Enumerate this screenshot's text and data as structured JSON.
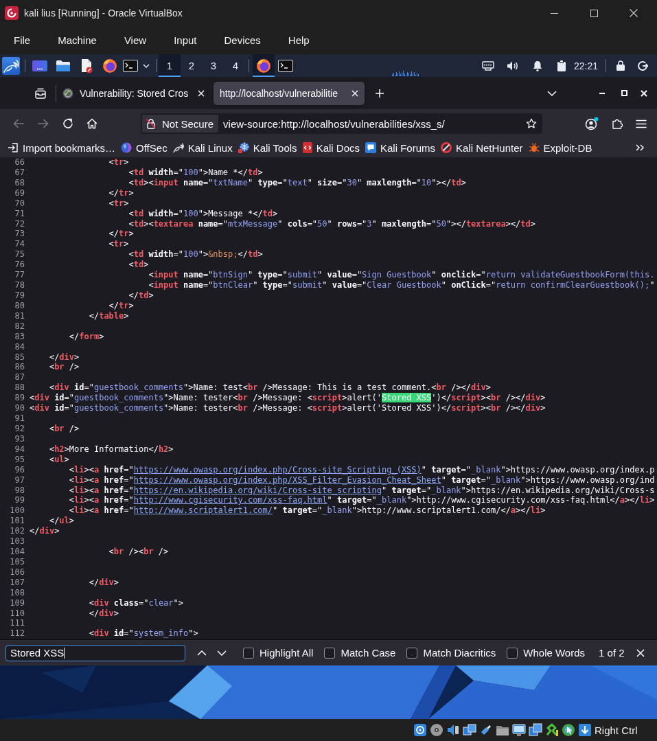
{
  "window": {
    "title": "kali lius [Running] - Oracle VirtualBox"
  },
  "menu_bar": [
    "File",
    "Machine",
    "View",
    "Input",
    "Devices",
    "Help"
  ],
  "panel": {
    "workspaces": [
      {
        "label": "1",
        "selected": true
      },
      {
        "label": "2",
        "selected": false
      },
      {
        "label": "3",
        "selected": false
      },
      {
        "label": "4",
        "selected": false
      }
    ],
    "tasks": [
      {
        "kind": "browser",
        "selected": true
      },
      {
        "kind": "terminal",
        "selected": false
      }
    ],
    "clock": "22:21"
  },
  "browser": {
    "tabs": [
      {
        "title": "Vulnerability: Stored Cros",
        "favicon": true,
        "selected": false
      },
      {
        "title": "http://localhost/vulnerabilitie",
        "favicon": false,
        "selected": true
      }
    ],
    "nav_buttons": [
      {
        "kind": "back",
        "disabled": true
      },
      {
        "kind": "forward",
        "disabled": true
      },
      {
        "kind": "reload",
        "disabled": false
      },
      {
        "kind": "home",
        "disabled": false
      }
    ],
    "security_label": "Not Secure",
    "url": "view-source:http://localhost/vulnerabilities/xss_s/",
    "bookmarks": [
      {
        "kind": "import",
        "label": "Import bookmarks…"
      },
      {
        "kind": "orb",
        "label": "OffSec"
      },
      {
        "kind": "dragon",
        "label": "Kali Linux"
      },
      {
        "kind": "globe",
        "label": "Kali Tools"
      },
      {
        "kind": "document",
        "label": "Kali Docs"
      },
      {
        "kind": "chat",
        "label": "Kali Forums"
      },
      {
        "kind": "ring",
        "label": "Kali NetHunter"
      },
      {
        "kind": "bug",
        "label": "Exploit-DB"
      }
    ]
  },
  "source": {
    "lines": [
      {
        "number": "66",
        "segments": [
          {
            "kind": "plain",
            "text": "                <"
          },
          {
            "kind": "tag",
            "text": "tr"
          },
          {
            "kind": "plain",
            "text": ">"
          }
        ]
      },
      {
        "number": "67",
        "segments": [
          {
            "kind": "plain",
            "text": "                    <"
          },
          {
            "kind": "tag",
            "text": "td"
          },
          {
            "kind": "attr",
            "text": " width"
          },
          {
            "kind": "plain",
            "text": "=\""
          },
          {
            "kind": "value",
            "text": "100"
          },
          {
            "kind": "plain",
            "text": "\">Name *</"
          },
          {
            "kind": "tag",
            "text": "td"
          },
          {
            "kind": "plain",
            "text": ">"
          }
        ]
      },
      {
        "number": "68",
        "segments": [
          {
            "kind": "plain",
            "text": "                    <"
          },
          {
            "kind": "tag",
            "text": "td"
          },
          {
            "kind": "plain",
            "text": "><"
          },
          {
            "kind": "tag",
            "text": "input"
          },
          {
            "kind": "attr",
            "text": " name"
          },
          {
            "kind": "plain",
            "text": "=\""
          },
          {
            "kind": "value",
            "text": "txtName"
          },
          {
            "kind": "plain",
            "text": "\" "
          },
          {
            "kind": "attr",
            "text": "type"
          },
          {
            "kind": "plain",
            "text": "=\""
          },
          {
            "kind": "value",
            "text": "text"
          },
          {
            "kind": "plain",
            "text": "\" "
          },
          {
            "kind": "attr",
            "text": "size"
          },
          {
            "kind": "plain",
            "text": "=\""
          },
          {
            "kind": "value",
            "text": "30"
          },
          {
            "kind": "plain",
            "text": "\" "
          },
          {
            "kind": "attr",
            "text": "maxlength"
          },
          {
            "kind": "plain",
            "text": "=\""
          },
          {
            "kind": "value",
            "text": "10"
          },
          {
            "kind": "plain",
            "text": "\"></"
          },
          {
            "kind": "tag",
            "text": "td"
          },
          {
            "kind": "plain",
            "text": ">"
          }
        ]
      },
      {
        "number": "69",
        "segments": [
          {
            "kind": "plain",
            "text": "                </"
          },
          {
            "kind": "tag",
            "text": "tr"
          },
          {
            "kind": "plain",
            "text": ">"
          }
        ]
      },
      {
        "number": "70",
        "segments": [
          {
            "kind": "plain",
            "text": "                <"
          },
          {
            "kind": "tag",
            "text": "tr"
          },
          {
            "kind": "plain",
            "text": ">"
          }
        ]
      },
      {
        "number": "71",
        "segments": [
          {
            "kind": "plain",
            "text": "                    <"
          },
          {
            "kind": "tag",
            "text": "td"
          },
          {
            "kind": "attr",
            "text": " width"
          },
          {
            "kind": "plain",
            "text": "=\""
          },
          {
            "kind": "value",
            "text": "100"
          },
          {
            "kind": "plain",
            "text": "\">Message *</"
          },
          {
            "kind": "tag",
            "text": "td"
          },
          {
            "kind": "plain",
            "text": ">"
          }
        ]
      },
      {
        "number": "72",
        "segments": [
          {
            "kind": "plain",
            "text": "                    <"
          },
          {
            "kind": "tag",
            "text": "td"
          },
          {
            "kind": "plain",
            "text": "><"
          },
          {
            "kind": "tag",
            "text": "textarea"
          },
          {
            "kind": "attr",
            "text": " name"
          },
          {
            "kind": "plain",
            "text": "=\""
          },
          {
            "kind": "value",
            "text": "mtxMessage"
          },
          {
            "kind": "plain",
            "text": "\" "
          },
          {
            "kind": "attr",
            "text": "cols"
          },
          {
            "kind": "plain",
            "text": "=\""
          },
          {
            "kind": "value",
            "text": "50"
          },
          {
            "kind": "plain",
            "text": "\" "
          },
          {
            "kind": "attr",
            "text": "rows"
          },
          {
            "kind": "plain",
            "text": "=\""
          },
          {
            "kind": "value",
            "text": "3"
          },
          {
            "kind": "plain",
            "text": "\" "
          },
          {
            "kind": "attr",
            "text": "maxlength"
          },
          {
            "kind": "plain",
            "text": "=\""
          },
          {
            "kind": "value",
            "text": "50"
          },
          {
            "kind": "plain",
            "text": "\"></"
          },
          {
            "kind": "tag",
            "text": "textarea"
          },
          {
            "kind": "plain",
            "text": "></"
          },
          {
            "kind": "tag",
            "text": "td"
          },
          {
            "kind": "plain",
            "text": ">"
          }
        ]
      },
      {
        "number": "73",
        "segments": [
          {
            "kind": "plain",
            "text": "                </"
          },
          {
            "kind": "tag",
            "text": "tr"
          },
          {
            "kind": "plain",
            "text": ">"
          }
        ]
      },
      {
        "number": "74",
        "segments": [
          {
            "kind": "plain",
            "text": "                <"
          },
          {
            "kind": "tag",
            "text": "tr"
          },
          {
            "kind": "plain",
            "text": ">"
          }
        ]
      },
      {
        "number": "75",
        "segments": [
          {
            "kind": "plain",
            "text": "                    <"
          },
          {
            "kind": "tag",
            "text": "td"
          },
          {
            "kind": "attr",
            "text": " width"
          },
          {
            "kind": "plain",
            "text": "=\""
          },
          {
            "kind": "value",
            "text": "100"
          },
          {
            "kind": "plain",
            "text": "\">"
          },
          {
            "kind": "entity",
            "text": "&nbsp;"
          },
          {
            "kind": "plain",
            "text": "</"
          },
          {
            "kind": "tag",
            "text": "td"
          },
          {
            "kind": "plain",
            "text": ">"
          }
        ]
      },
      {
        "number": "76",
        "segments": [
          {
            "kind": "plain",
            "text": "                    <"
          },
          {
            "kind": "tag",
            "text": "td"
          },
          {
            "kind": "plain",
            "text": ">"
          }
        ]
      },
      {
        "number": "77",
        "segments": [
          {
            "kind": "plain",
            "text": "                        <"
          },
          {
            "kind": "tag",
            "text": "input"
          },
          {
            "kind": "attr",
            "text": " name"
          },
          {
            "kind": "plain",
            "text": "=\""
          },
          {
            "kind": "value",
            "text": "btnSign"
          },
          {
            "kind": "plain",
            "text": "\" "
          },
          {
            "kind": "attr",
            "text": "type"
          },
          {
            "kind": "plain",
            "text": "=\""
          },
          {
            "kind": "value",
            "text": "submit"
          },
          {
            "kind": "plain",
            "text": "\" "
          },
          {
            "kind": "attr",
            "text": "value"
          },
          {
            "kind": "plain",
            "text": "=\""
          },
          {
            "kind": "value",
            "text": "Sign Guestbook"
          },
          {
            "kind": "plain",
            "text": "\" "
          },
          {
            "kind": "attr",
            "text": "onclick"
          },
          {
            "kind": "plain",
            "text": "=\""
          },
          {
            "kind": "value",
            "text": "return validateGuestbookForm(this."
          }
        ]
      },
      {
        "number": "78",
        "segments": [
          {
            "kind": "plain",
            "text": "                        <"
          },
          {
            "kind": "tag",
            "text": "input"
          },
          {
            "kind": "attr",
            "text": " name"
          },
          {
            "kind": "plain",
            "text": "=\""
          },
          {
            "kind": "value",
            "text": "btnClear"
          },
          {
            "kind": "plain",
            "text": "\" "
          },
          {
            "kind": "attr",
            "text": "type"
          },
          {
            "kind": "plain",
            "text": "=\""
          },
          {
            "kind": "value",
            "text": "submit"
          },
          {
            "kind": "plain",
            "text": "\" "
          },
          {
            "kind": "attr",
            "text": "value"
          },
          {
            "kind": "plain",
            "text": "=\""
          },
          {
            "kind": "value",
            "text": "Clear Guestbook"
          },
          {
            "kind": "plain",
            "text": "\" "
          },
          {
            "kind": "attr",
            "text": "onClick"
          },
          {
            "kind": "plain",
            "text": "=\""
          },
          {
            "kind": "value",
            "text": "return confirmClearGuestbook();"
          },
          {
            "kind": "plain",
            "text": "\""
          }
        ]
      },
      {
        "number": "79",
        "segments": [
          {
            "kind": "plain",
            "text": "                    </"
          },
          {
            "kind": "tag",
            "text": "td"
          },
          {
            "kind": "plain",
            "text": ">"
          }
        ]
      },
      {
        "number": "80",
        "segments": [
          {
            "kind": "plain",
            "text": "                </"
          },
          {
            "kind": "tag",
            "text": "tr"
          },
          {
            "kind": "plain",
            "text": ">"
          }
        ]
      },
      {
        "number": "81",
        "segments": [
          {
            "kind": "plain",
            "text": "            </"
          },
          {
            "kind": "tag",
            "text": "table"
          },
          {
            "kind": "plain",
            "text": ">"
          }
        ]
      },
      {
        "number": "82"
      },
      {
        "number": "83",
        "segments": [
          {
            "kind": "plain",
            "text": "        </"
          },
          {
            "kind": "tag",
            "text": "form"
          },
          {
            "kind": "plain",
            "text": ">"
          }
        ]
      },
      {
        "number": "84"
      },
      {
        "number": "85",
        "segments": [
          {
            "kind": "plain",
            "text": "    </"
          },
          {
            "kind": "tag",
            "text": "div"
          },
          {
            "kind": "plain",
            "text": ">"
          }
        ]
      },
      {
        "number": "86",
        "segments": [
          {
            "kind": "plain",
            "text": "    <"
          },
          {
            "kind": "tag",
            "text": "br"
          },
          {
            "kind": "plain",
            "text": " />"
          }
        ]
      },
      {
        "number": "87"
      },
      {
        "number": "88",
        "segments": [
          {
            "kind": "plain",
            "text": "    <"
          },
          {
            "kind": "tag",
            "text": "div"
          },
          {
            "kind": "attr",
            "text": " id"
          },
          {
            "kind": "plain",
            "text": "=\""
          },
          {
            "kind": "value",
            "text": "guestbook_comments"
          },
          {
            "kind": "plain",
            "text": "\">Name: test<"
          },
          {
            "kind": "tag",
            "text": "br"
          },
          {
            "kind": "plain",
            "text": " />Message: This is a test comment.<"
          },
          {
            "kind": "tag",
            "text": "br"
          },
          {
            "kind": "plain",
            "text": " /></"
          },
          {
            "kind": "tag",
            "text": "div"
          },
          {
            "kind": "plain",
            "text": ">"
          }
        ]
      },
      {
        "number": "89",
        "segments": [
          {
            "kind": "plain",
            "text": "<"
          },
          {
            "kind": "tag",
            "text": "div"
          },
          {
            "kind": "attr",
            "text": " id"
          },
          {
            "kind": "plain",
            "text": "=\""
          },
          {
            "kind": "value",
            "text": "guestbook_comments"
          },
          {
            "kind": "plain",
            "text": "\">Name: tester<"
          },
          {
            "kind": "tag",
            "text": "br"
          },
          {
            "kind": "plain",
            "text": " />Message: <"
          },
          {
            "kind": "tag",
            "text": "script"
          },
          {
            "kind": "plain",
            "text": ">alert('"
          },
          {
            "kind": "match",
            "text": "Stored XSS"
          },
          {
            "kind": "plain",
            "text": "')</"
          },
          {
            "kind": "tag",
            "text": "script"
          },
          {
            "kind": "plain",
            "text": "><"
          },
          {
            "kind": "tag",
            "text": "br"
          },
          {
            "kind": "plain",
            "text": " /></"
          },
          {
            "kind": "tag",
            "text": "div"
          },
          {
            "kind": "plain",
            "text": ">"
          }
        ]
      },
      {
        "number": "90",
        "segments": [
          {
            "kind": "plain",
            "text": "<"
          },
          {
            "kind": "tag",
            "text": "div"
          },
          {
            "kind": "attr",
            "text": " id"
          },
          {
            "kind": "plain",
            "text": "=\""
          },
          {
            "kind": "value",
            "text": "guestbook_comments"
          },
          {
            "kind": "plain",
            "text": "\">Name: tester<"
          },
          {
            "kind": "tag",
            "text": "br"
          },
          {
            "kind": "plain",
            "text": " />Message: <"
          },
          {
            "kind": "tag",
            "text": "script"
          },
          {
            "kind": "plain",
            "text": ">alert('Stored XSS')</"
          },
          {
            "kind": "tag",
            "text": "script"
          },
          {
            "kind": "plain",
            "text": "><"
          },
          {
            "kind": "tag",
            "text": "br"
          },
          {
            "kind": "plain",
            "text": " /></"
          },
          {
            "kind": "tag",
            "text": "div"
          },
          {
            "kind": "plain",
            "text": ">"
          }
        ]
      },
      {
        "number": "91"
      },
      {
        "number": "92",
        "segments": [
          {
            "kind": "plain",
            "text": "    <"
          },
          {
            "kind": "tag",
            "text": "br"
          },
          {
            "kind": "plain",
            "text": " />"
          }
        ]
      },
      {
        "number": "93"
      },
      {
        "number": "94",
        "segments": [
          {
            "kind": "plain",
            "text": "    <"
          },
          {
            "kind": "tag",
            "text": "h2"
          },
          {
            "kind": "plain",
            "text": ">More Information</"
          },
          {
            "kind": "tag",
            "text": "h2"
          },
          {
            "kind": "plain",
            "text": ">"
          }
        ]
      },
      {
        "number": "95",
        "segments": [
          {
            "kind": "plain",
            "text": "    <"
          },
          {
            "kind": "tag",
            "text": "ul"
          },
          {
            "kind": "plain",
            "text": ">"
          }
        ]
      },
      {
        "number": "96",
        "segments": [
          {
            "kind": "plain",
            "text": "        <"
          },
          {
            "kind": "tag",
            "text": "li"
          },
          {
            "kind": "plain",
            "text": "><"
          },
          {
            "kind": "tag",
            "text": "a"
          },
          {
            "kind": "attr",
            "text": " href"
          },
          {
            "kind": "plain",
            "text": "=\""
          },
          {
            "kind": "link",
            "text": "https://www.owasp.org/index.php/Cross-site_Scripting_(XSS)"
          },
          {
            "kind": "plain",
            "text": "\" "
          },
          {
            "kind": "attr",
            "text": "target"
          },
          {
            "kind": "plain",
            "text": "=\""
          },
          {
            "kind": "value",
            "text": "_blank"
          },
          {
            "kind": "plain",
            "text": "\">https://www.owasp.org/index.p"
          }
        ]
      },
      {
        "number": "97",
        "segments": [
          {
            "kind": "plain",
            "text": "        <"
          },
          {
            "kind": "tag",
            "text": "li"
          },
          {
            "kind": "plain",
            "text": "><"
          },
          {
            "kind": "tag",
            "text": "a"
          },
          {
            "kind": "attr",
            "text": " href"
          },
          {
            "kind": "plain",
            "text": "=\""
          },
          {
            "kind": "link",
            "text": "https://www.owasp.org/index.php/XSS_Filter_Evasion_Cheat_Sheet"
          },
          {
            "kind": "plain",
            "text": "\" "
          },
          {
            "kind": "attr",
            "text": "target"
          },
          {
            "kind": "plain",
            "text": "=\""
          },
          {
            "kind": "value",
            "text": "_blank"
          },
          {
            "kind": "plain",
            "text": "\">https://www.owasp.org/ind"
          }
        ]
      },
      {
        "number": "98",
        "segments": [
          {
            "kind": "plain",
            "text": "        <"
          },
          {
            "kind": "tag",
            "text": "li"
          },
          {
            "kind": "plain",
            "text": "><"
          },
          {
            "kind": "tag",
            "text": "a"
          },
          {
            "kind": "attr",
            "text": " href"
          },
          {
            "kind": "plain",
            "text": "=\""
          },
          {
            "kind": "link",
            "text": "https://en.wikipedia.org/wiki/Cross-site_scripting"
          },
          {
            "kind": "plain",
            "text": "\" "
          },
          {
            "kind": "attr",
            "text": "target"
          },
          {
            "kind": "plain",
            "text": "=\""
          },
          {
            "kind": "value",
            "text": "_blank"
          },
          {
            "kind": "plain",
            "text": "\">https://en.wikipedia.org/wiki/Cross-s"
          }
        ]
      },
      {
        "number": "99",
        "segments": [
          {
            "kind": "plain",
            "text": "        <"
          },
          {
            "kind": "tag",
            "text": "li"
          },
          {
            "kind": "plain",
            "text": "><"
          },
          {
            "kind": "tag",
            "text": "a"
          },
          {
            "kind": "attr",
            "text": " href"
          },
          {
            "kind": "plain",
            "text": "=\""
          },
          {
            "kind": "link",
            "text": "http://www.cgisecurity.com/xss-faq.html"
          },
          {
            "kind": "plain",
            "text": "\" "
          },
          {
            "kind": "attr",
            "text": "target"
          },
          {
            "kind": "plain",
            "text": "=\""
          },
          {
            "kind": "value",
            "text": "_blank"
          },
          {
            "kind": "plain",
            "text": "\">http://www.cgisecurity.com/xss-faq.html</"
          },
          {
            "kind": "tag",
            "text": "a"
          },
          {
            "kind": "plain",
            "text": "></"
          },
          {
            "kind": "tag",
            "text": "li"
          },
          {
            "kind": "plain",
            "text": ">"
          }
        ]
      },
      {
        "number": "100",
        "segments": [
          {
            "kind": "plain",
            "text": "        <"
          },
          {
            "kind": "tag",
            "text": "li"
          },
          {
            "kind": "plain",
            "text": "><"
          },
          {
            "kind": "tag",
            "text": "a"
          },
          {
            "kind": "attr",
            "text": " href"
          },
          {
            "kind": "plain",
            "text": "=\""
          },
          {
            "kind": "link",
            "text": "http://www.scriptalert1.com/"
          },
          {
            "kind": "plain",
            "text": "\" "
          },
          {
            "kind": "attr",
            "text": "target"
          },
          {
            "kind": "plain",
            "text": "=\""
          },
          {
            "kind": "value",
            "text": "_blank"
          },
          {
            "kind": "plain",
            "text": "\">http://www.scriptalert1.com/</"
          },
          {
            "kind": "tag",
            "text": "a"
          },
          {
            "kind": "plain",
            "text": "></"
          },
          {
            "kind": "tag",
            "text": "li"
          },
          {
            "kind": "plain",
            "text": ">"
          }
        ]
      },
      {
        "number": "101",
        "segments": [
          {
            "kind": "plain",
            "text": "    </"
          },
          {
            "kind": "tag",
            "text": "ul"
          },
          {
            "kind": "plain",
            "text": ">"
          }
        ]
      },
      {
        "number": "102",
        "segments": [
          {
            "kind": "plain",
            "text": "</"
          },
          {
            "kind": "tag",
            "text": "div"
          },
          {
            "kind": "plain",
            "text": ">"
          }
        ]
      },
      {
        "number": "103"
      },
      {
        "number": "104",
        "segments": [
          {
            "kind": "plain",
            "text": "                <"
          },
          {
            "kind": "tag",
            "text": "br"
          },
          {
            "kind": "plain",
            "text": " /><"
          },
          {
            "kind": "tag",
            "text": "br"
          },
          {
            "kind": "plain",
            "text": " />"
          }
        ]
      },
      {
        "number": "105"
      },
      {
        "number": "106"
      },
      {
        "number": "107",
        "segments": [
          {
            "kind": "plain",
            "text": "            </"
          },
          {
            "kind": "tag",
            "text": "div"
          },
          {
            "kind": "plain",
            "text": ">"
          }
        ]
      },
      {
        "number": "108"
      },
      {
        "number": "109",
        "segments": [
          {
            "kind": "plain",
            "text": "            <"
          },
          {
            "kind": "tag",
            "text": "div"
          },
          {
            "kind": "attr",
            "text": " class"
          },
          {
            "kind": "plain",
            "text": "=\""
          },
          {
            "kind": "value",
            "text": "clear"
          },
          {
            "kind": "plain",
            "text": "\">"
          }
        ]
      },
      {
        "number": "110",
        "segments": [
          {
            "kind": "plain",
            "text": "            </"
          },
          {
            "kind": "tag",
            "text": "div"
          },
          {
            "kind": "plain",
            "text": ">"
          }
        ]
      },
      {
        "number": "111"
      },
      {
        "number": "112",
        "segments": [
          {
            "kind": "plain",
            "text": "            <"
          },
          {
            "kind": "tag",
            "text": "div"
          },
          {
            "kind": "attr",
            "text": " id"
          },
          {
            "kind": "plain",
            "text": "=\""
          },
          {
            "kind": "value",
            "text": "system_info"
          },
          {
            "kind": "plain",
            "text": "\">"
          }
        ]
      }
    ]
  },
  "find_bar": {
    "query": "Stored XSS",
    "options": [
      {
        "label": "Highlight All",
        "checked": false
      },
      {
        "label": "Match Case",
        "checked": false
      },
      {
        "label": "Match Diacritics",
        "checked": false
      },
      {
        "label": "Whole Words",
        "checked": false
      }
    ],
    "result": "1 of 2"
  },
  "status_bar": {
    "host_key": "Right Ctrl"
  }
}
